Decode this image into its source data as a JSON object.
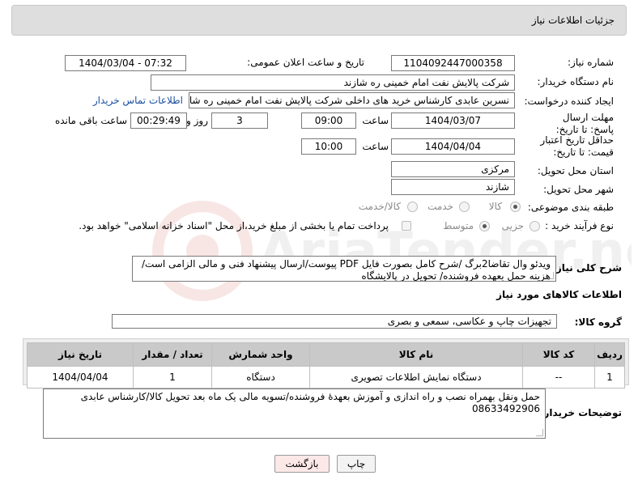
{
  "page": {
    "title": "جزئیات اطلاعات نیاز"
  },
  "watermark": {
    "text": "AriaTender.neT"
  },
  "fields": {
    "need_number_label": "شماره نیاز:",
    "need_number": "1104092447000358",
    "announce_label": "تاریخ و ساعت اعلان عمومی:",
    "announce_value": "1404/03/04 - 07:32",
    "buyer_label": "نام دستگاه خریدار:",
    "buyer_value": "شرکت پالایش نفت امام خمینی  ره  شازند",
    "creator_label": "ایجاد کننده درخواست:",
    "creator_value": "نسرین عابدی کارشناس خرید های داخلی  شرکت پالایش نفت امام خمینی  ره  شازند",
    "contact_link": "اطلاعات تماس خریدار",
    "reply_deadline_label": "مهلت ارسال پاسخ: تا تاریخ:",
    "reply_date": "1404/03/07",
    "time_label": "ساعت",
    "reply_time": "09:00",
    "days_value": "3",
    "days_label": "روز و",
    "remaining_value": "00:29:49",
    "remaining_label": "ساعت باقی مانده",
    "price_validity_label": "حداقل تاریخ اعتبار قیمت: تا تاریخ:",
    "price_date": "1404/04/04",
    "price_time_label": "ساعت",
    "price_time": "10:00",
    "province_label": "استان محل تحویل:",
    "province_value": "مرکزی",
    "city_label": "شهر محل تحویل:",
    "city_value": "شازند",
    "category_label": "طبقه بندی موضوعی:",
    "category_options": [
      "کالا",
      "خدمت",
      "کالا/خدمت"
    ],
    "process_label": "نوع فرآیند خرید :",
    "process_options": [
      "جزیی",
      "متوسط"
    ],
    "payment_note": "پرداخت تمام یا بخشی از مبلغ خرید،از محل \"اسناد خزانه اسلامی\" خواهد بود."
  },
  "description": {
    "label": "شرح کلی نیاز:",
    "text": "ویدئو وال تقاضا2برگ /شرح کامل بصورت فایل PDF پیوست/ارسال پیشنهاد فنی و مالی الزامی است/هزینه حمل بعهده فروشنده/ تحویل در پالایشگاه"
  },
  "goods_section": {
    "title": "اطلاعات کالاهای مورد نیاز",
    "group_label": "گروه کالا:",
    "group_value": "تجهیزات چاپ و عکاسی، سمعی و بصری"
  },
  "table": {
    "headers": [
      "ردیف",
      "کد کالا",
      "نام کالا",
      "واحد شمارش",
      "تعداد / مقدار",
      "تاریخ نیاز"
    ],
    "rows": [
      [
        "1",
        "--",
        "دستگاه نمایش اطلاعات تصویری",
        "دستگاه",
        "1",
        "1404/04/04"
      ]
    ]
  },
  "buyer_notes": {
    "label": "توضیحات خریدار:",
    "text": "حمل ونقل بهمراه نصب و راه اندازی و آموزش بعهدۀ فروشنده/تسویه مالی یک ماه بعد تحویل کالا/کارشناس عابدی 08633492906"
  },
  "buttons": {
    "print": "چاپ",
    "back": "بازگشت"
  },
  "colors": {
    "back_button_bg": "#fde8e8",
    "link": "#1a4fa0",
    "title_bg": "#dedede"
  }
}
